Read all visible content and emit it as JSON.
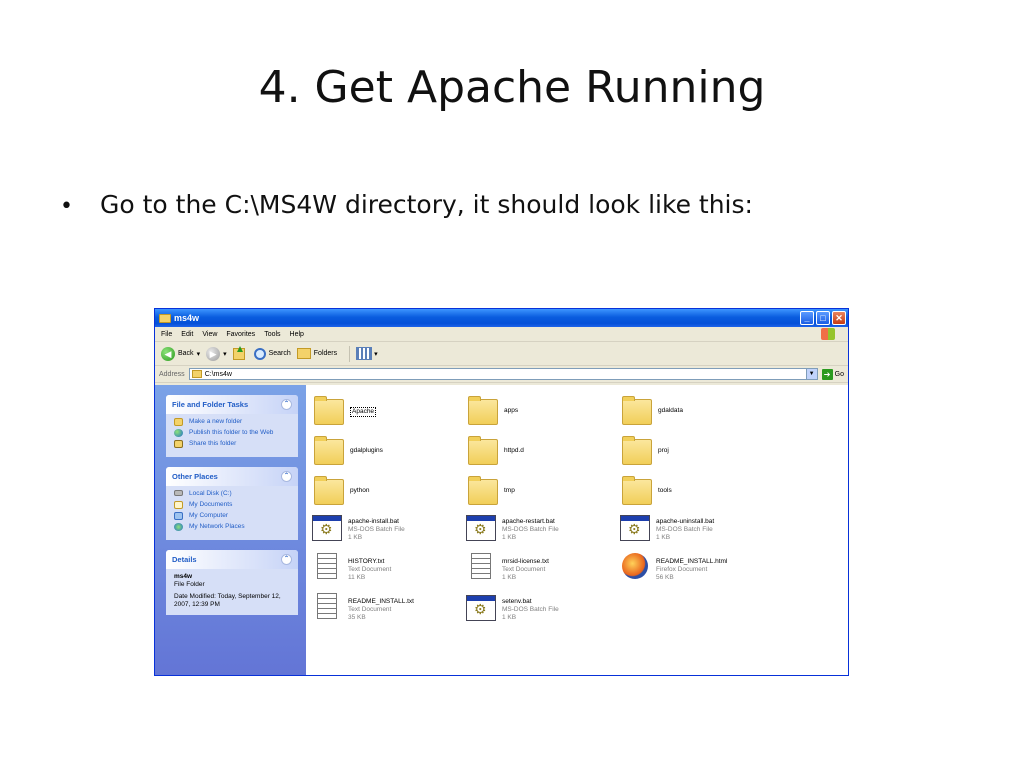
{
  "slide": {
    "title": "4. Get Apache Running",
    "bullet": "Go to the C:\\MS4W directory, it should look like this:"
  },
  "window": {
    "title": "ms4w",
    "menu": [
      "File",
      "Edit",
      "View",
      "Favorites",
      "Tools",
      "Help"
    ],
    "toolbar": {
      "back": "Back",
      "search": "Search",
      "folders": "Folders"
    },
    "address": {
      "label": "Address",
      "path": "C:\\ms4w",
      "go": "Go"
    },
    "sidebar": {
      "tasks": {
        "header": "File and Folder Tasks",
        "items": [
          "Make a new folder",
          "Publish this folder to the Web",
          "Share this folder"
        ]
      },
      "places": {
        "header": "Other Places",
        "items": [
          "Local Disk (C:)",
          "My Documents",
          "My Computer",
          "My Network Places"
        ]
      },
      "details": {
        "header": "Details",
        "name": "ms4w",
        "type": "File Folder",
        "modified": "Date Modified: Today, September 12, 2007, 12:39 PM"
      }
    },
    "files": [
      {
        "name": "Apache",
        "type": "",
        "size": "",
        "icon": "folder-icon"
      },
      {
        "name": "apps",
        "type": "",
        "size": "",
        "icon": "folder-icon"
      },
      {
        "name": "gdaldata",
        "type": "",
        "size": "",
        "icon": "folder-icon"
      },
      {
        "name": "gdalplugins",
        "type": "",
        "size": "",
        "icon": "folder-icon"
      },
      {
        "name": "httpd.d",
        "type": "",
        "size": "",
        "icon": "folder-icon"
      },
      {
        "name": "proj",
        "type": "",
        "size": "",
        "icon": "folder-icon"
      },
      {
        "name": "python",
        "type": "",
        "size": "",
        "icon": "folder-icon"
      },
      {
        "name": "tmp",
        "type": "",
        "size": "",
        "icon": "folder-icon"
      },
      {
        "name": "tools",
        "type": "",
        "size": "",
        "icon": "folder-icon"
      },
      {
        "name": "apache-install.bat",
        "type": "MS-DOS Batch File",
        "size": "1 KB",
        "icon": "batch-file-icon"
      },
      {
        "name": "apache-restart.bat",
        "type": "MS-DOS Batch File",
        "size": "1 KB",
        "icon": "batch-file-icon"
      },
      {
        "name": "apache-uninstall.bat",
        "type": "MS-DOS Batch File",
        "size": "1 KB",
        "icon": "batch-file-icon"
      },
      {
        "name": "HISTORY.txt",
        "type": "Text Document",
        "size": "11 KB",
        "icon": "text-file-icon"
      },
      {
        "name": "mrsid-license.txt",
        "type": "Text Document",
        "size": "1 KB",
        "icon": "text-file-icon"
      },
      {
        "name": "README_INSTALL.html",
        "type": "Firefox Document",
        "size": "56 KB",
        "icon": "firefox-document-icon"
      },
      {
        "name": "README_INSTALL.txt",
        "type": "Text Document",
        "size": "35 KB",
        "icon": "text-file-icon"
      },
      {
        "name": "setenv.bat",
        "type": "MS-DOS Batch File",
        "size": "1 KB",
        "icon": "batch-file-icon"
      }
    ]
  }
}
